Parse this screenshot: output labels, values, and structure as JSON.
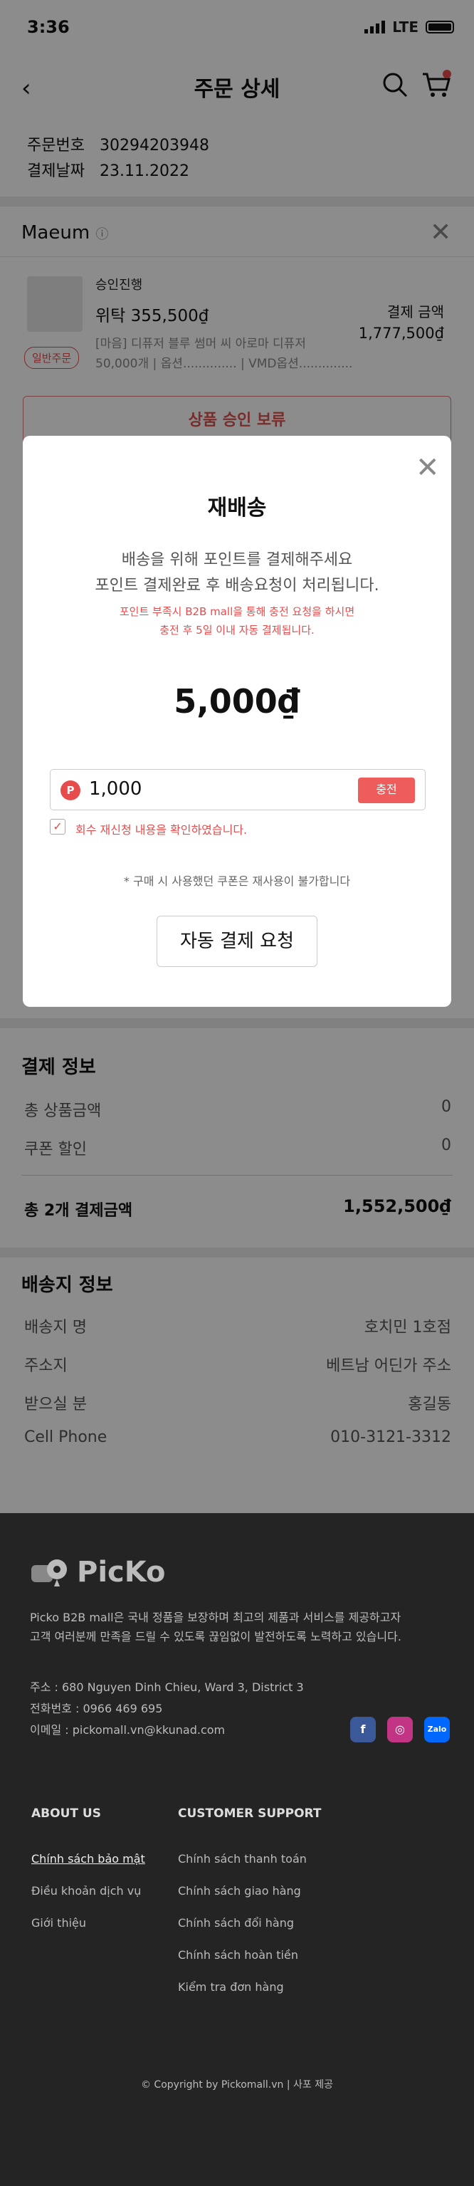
{
  "status_bar": {
    "time": "3:36",
    "network": "LTE"
  },
  "header": {
    "title": "주문 상세"
  },
  "order": {
    "number_label": "주문번호",
    "number": "30294203948",
    "date_label": "결제날짜",
    "date": "23.11.2022"
  },
  "seller": {
    "name": "Maeum",
    "item": {
      "status": "승인진행",
      "name": "위탁  355,500₫",
      "desc_line1": "[마음] 디퓨저 블루 썸머 씨 아로마 디퓨저",
      "desc_line2": "50,000개 | 옵션.............. | VMD옵션..............",
      "tag": "일반주문",
      "pay_label": "결제 금액",
      "pay_value": "1,777,500₫"
    },
    "hold_button": "상품 승인 보류"
  },
  "payment_info": {
    "title": "결제 정보",
    "subtotal_label": "총 상품금액",
    "subtotal_value": "0",
    "coupon_label": "쿠폰 할인",
    "coupon_value": "0",
    "total_label": "총 2개 결제금액",
    "total_value": "1,552,500₫"
  },
  "shipping_info": {
    "title": "배송지 정보",
    "rows": [
      {
        "label": "배송지 명",
        "value": "호치민 1호점"
      },
      {
        "label": "주소지",
        "value": "베트남 어딘가 주소"
      },
      {
        "label": "받으실 분",
        "value": "홍길동"
      },
      {
        "label": "Cell Phone",
        "value": "010-3121-3312"
      }
    ]
  },
  "modal": {
    "title": "재배송",
    "desc_line1": "배송을 위해 포인트를 결제해주세요",
    "desc_line2": "포인트 결제완료 후 배송요청이 처리됩니다.",
    "warn_line1": "포인트 부족시 B2B mall을 통해 충전 요청을 하시면",
    "warn_line2": "충전 후 5일 이내 자동 결제됩니다.",
    "amount": "5,000₫",
    "point_icon": "P",
    "point_value": "1,000",
    "charge_button": "충전",
    "confirm_label": "회수 재신청 내용을 확인하였습니다.",
    "note": "* 구매 시 사용했던 쿠폰은 재사용이 불가합니다",
    "request_button": "자동 결제 요청"
  },
  "footer": {
    "logo_text": "PicKo",
    "desc_line1": "Picko B2B mall은 국내 정품을 보장하며 최고의 제품과 서비스를 제공하고자",
    "desc_line2": "고객 여러분께 만족을 드릴 수 있도록 끊임없이 발전하도록 노력하고 있습니다.",
    "address": "주소 : 680 Nguyen Dinh Chieu, Ward 3, District 3",
    "phone": "전화번호 : 0966 469 695",
    "email": "이메일 : pickomall.vn@kkunad.com",
    "social": {
      "facebook": "f",
      "instagram": "◎",
      "zalo": "Zalo"
    },
    "about_title": "ABOUT US",
    "about_links": [
      "Chính sách bảo mật",
      "Điều khoản dịch vụ",
      "Giới thiệu"
    ],
    "support_title": "CUSTOMER SUPPORT",
    "support_links": [
      "Chính sách thanh toán",
      "Chính sách giao hàng",
      "Chính sách đổi hàng",
      "Chính sách hoàn tiền",
      "Kiểm tra đơn hàng"
    ],
    "copyright": "© Copyright by Pickomall.vn | 사포 제공"
  },
  "colors": {
    "accent": "#e74c4c",
    "footer_bg": "#242424",
    "overlay": "rgba(0,0,0,0.45)"
  }
}
